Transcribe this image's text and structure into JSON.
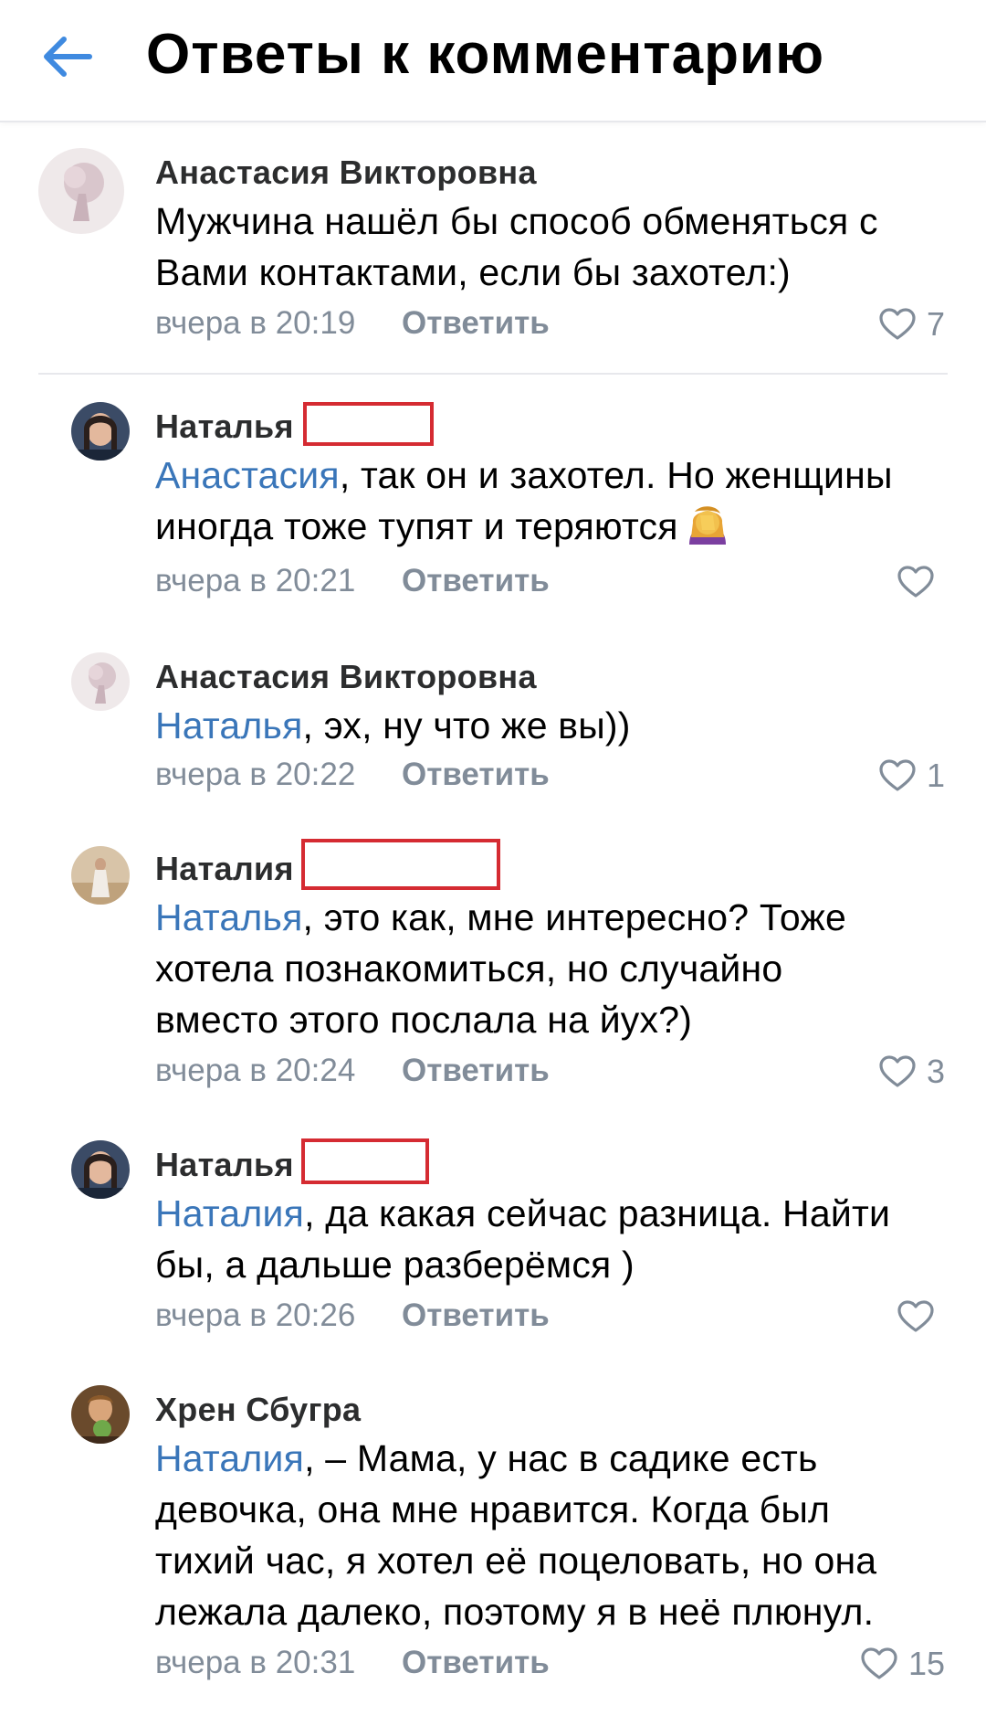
{
  "header": {
    "title": "Ответы к комментарию"
  },
  "comments": [
    {
      "author": "Анастасия Викторовна",
      "text_lines": [
        "Мужчина нашёл бы способ обменяться с",
        "Вами контактами, если бы захотел:)"
      ],
      "time": "вчера в 20:19",
      "reply_label": "Ответить",
      "likes": "7"
    },
    {
      "author": "Наталья",
      "mention": "Анастасия",
      "text_lines": [
        ", так он и захотел. Но женщины",
        "иногда тоже тупят и теряются"
      ],
      "emoji": "woman-facepalming",
      "time": "вчера в 20:21",
      "reply_label": "Ответить",
      "likes": ""
    },
    {
      "author": "Анастасия Викторовна",
      "mention": "Наталья",
      "text_lines": [
        ", эх, ну что же вы))"
      ],
      "time": "вчера в 20:22",
      "reply_label": "Ответить",
      "likes": "1"
    },
    {
      "author": "Наталия",
      "mention": "Наталья",
      "text_lines": [
        ", это как, мне интересно? Тоже",
        "хотела познакомиться, но случайно",
        "вместо этого послала на йух?)"
      ],
      "time": "вчера в 20:24",
      "reply_label": "Ответить",
      "likes": "3"
    },
    {
      "author": "Наталья",
      "mention": "Наталия",
      "text_lines": [
        ", да какая сейчас разница. Найти",
        "бы, а дальше разберёмся )"
      ],
      "time": "вчера в 20:26",
      "reply_label": "Ответить",
      "likes": ""
    },
    {
      "author": "Хрен Сбугра",
      "mention": "Наталия",
      "text_lines": [
        ", – Мама, у нас в садике есть",
        "девочка, она мне нравится. Когда был",
        "тихий час, я хотел её поцеловать, но она",
        "лежала далеко, поэтому я в неё плюнул."
      ],
      "time": "вчера в 20:31",
      "reply_label": "Ответить",
      "likes": "15"
    }
  ],
  "colors": {
    "link": "#3a76b9",
    "meta": "#818c99",
    "redaction": "#d52b32",
    "back_arrow": "#3f8ae0"
  }
}
